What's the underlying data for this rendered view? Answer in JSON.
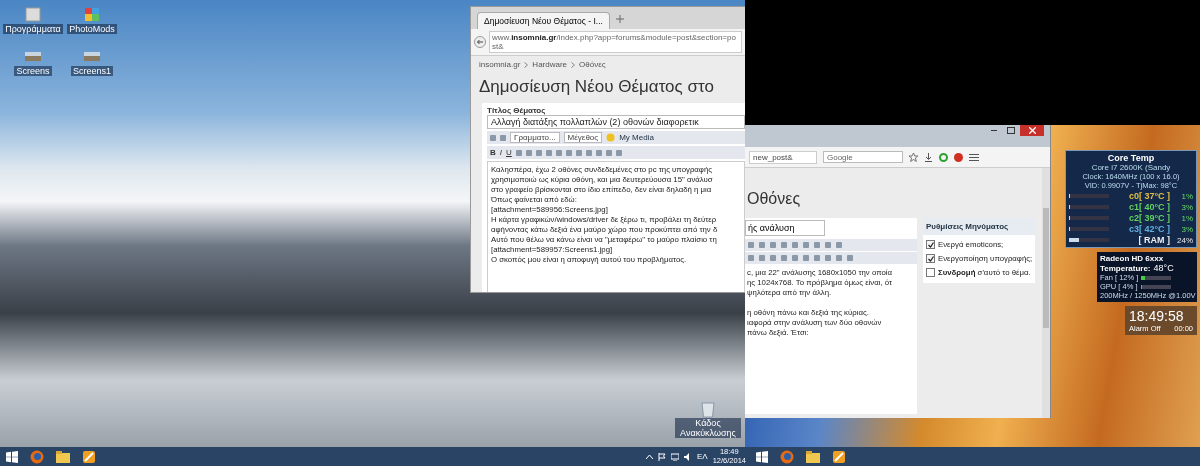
{
  "desktop_icons": [
    {
      "label": "Προγράμματα",
      "kind": "folder"
    },
    {
      "label": "PhotoMods",
      "kind": "cube"
    },
    {
      "label": "Screens",
      "kind": "image"
    },
    {
      "label": "Screens1",
      "kind": "image"
    }
  ],
  "recycle_bin": {
    "label": "Κάδος Ανακύκλωσης"
  },
  "browser_left": {
    "tab_title": "Δημοσίευση Νέου Θέματος - I...",
    "url_prefix": "www.",
    "url_domain": "insomnia.gr",
    "url_path": "/index.php?app=forums&module=post&section=post&",
    "breadcrumbs": [
      "insomnia.gr",
      "Hardware",
      "Οθόνες"
    ],
    "heading": "Δημοσίευση Νέου Θέματος στο",
    "title_label": "Τίτλος Θέματος",
    "title_value": "Αλλαγή διατάξης πολλαπλών (2) οθονών διαφορετικ",
    "font_select": "Γραμματο...",
    "size_select": "Μέγεθος",
    "media_button": "My Media",
    "format_buttons": [
      "B",
      "I",
      "U"
    ],
    "body_lines": [
      "Καλησπέρα, έχω 2 οθόνες συνδεδεμένες στο pc της υπογραφής",
      "χρησιμοποιώ ως κύρια οθόνη, και μια δευτερεύουσα 15\" ανάλυσ",
      "στο γραφείο βρίσκονται στο ίδιο επίπεδο, δεν είναι δηλαδή η μια",
      "Όπως φαίνεται από εδώ:",
      "[attachment=589956:Screens.jpg]",
      "Η κάρτα γραφικών/windows/driver δε ξέρω τι, προβάλει τη δεύτερ",
      "αφήνοντας κάτω δεξιά ένα μαύρο χώρο που προκύπτει από την δ",
      "Αυτό που θέλω να κάνω είναι να \"μεταφέρω\" το μαύρο πλαίσιο τη",
      "[attachment=589957:Screens1.jpg]",
      "Ο σκοπός μου είναι η αποφυγή αυτού του προβλήματος."
    ]
  },
  "browser_right": {
    "url_tail": "new_post&",
    "search": {
      "placeholder": "Google"
    },
    "heading": "Οθόνες",
    "title_value": "ής ανάλυση",
    "paragraphs": [
      [
        "c, μια 22\" ανάλυσης 1680x1050 την οποία",
        "ης 1024x768. Το πρόβλημα όμως είναι, ότ",
        "ψηλότερα από την άλλη."
      ],
      [
        "η οθόνη πάνω και δεξιά της κύριας.",
        "ιαφορά στην ανάλυση των δύο οθονών",
        "πάνω δεξιά. Έτσι:"
      ]
    ],
    "settings_title": "Ρυθμίσεις Μηνύματος",
    "options": [
      {
        "label": "Ενεργά emoticons;",
        "checked": true
      },
      {
        "label": "Ενεργοποίηση υπογραφής;",
        "checked": true
      },
      {
        "label": "**Συνδρομή** σ'αυτό το θέμα.",
        "checked": false
      }
    ]
  },
  "core_temp": {
    "title": "Core Temp",
    "cpu": "Core i7 2600K (Sandy",
    "clock": "Clock: 1640MHz (100 x 16.0)",
    "vid": "VID: 0.9907V - TjMax: 98°C",
    "cores": [
      {
        "label": "c0[ 37°C ]",
        "load": "1%",
        "level": 0.01,
        "color": "#e0c040"
      },
      {
        "label": "c1[ 40°C ]",
        "load": "3%",
        "level": 0.03,
        "color": "#60d060"
      },
      {
        "label": "c2[ 39°C ]",
        "load": "1%",
        "level": 0.01,
        "color": "#60d060"
      },
      {
        "label": "c3[ 42°C ]",
        "load": "3%",
        "level": 0.03,
        "color": "#60b0e0"
      }
    ],
    "ram": {
      "label": "[ RAM ]",
      "load": "24%",
      "level": 0.24
    }
  },
  "gpu": {
    "name": "Radeon HD 6xxx",
    "temperature_label": "Temperature:",
    "temperature": "48°C",
    "fan": {
      "label": "Fan [ 12% ]",
      "level": 0.12
    },
    "load": {
      "label": "GPU [ 4% ]",
      "level": 0.04
    },
    "clocks": "200MHz / 1250MHz @1.00V"
  },
  "clock_gadget": {
    "time": "18:49:58",
    "alarm": "Alarm Off",
    "alarm_time": "00:00"
  },
  "taskbar": {
    "language": "ΕΛ",
    "time": "18:49",
    "date": "12/6/2014"
  }
}
